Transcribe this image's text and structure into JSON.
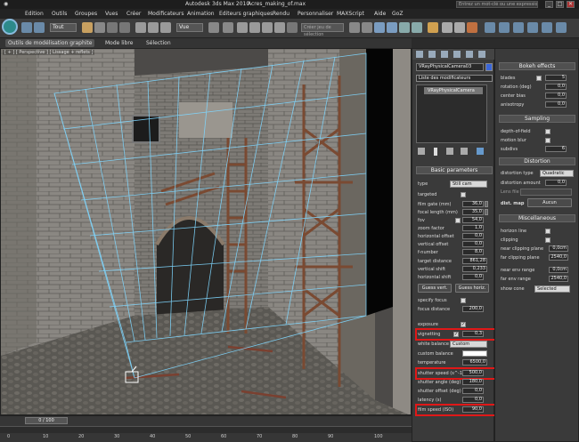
{
  "titlebar": {
    "app_title": "Autodesk 3ds Max 2010",
    "file_name": "Acres_making_of.max",
    "search_placeholder": "Entrez un mot-clé ou une expression",
    "min": "_",
    "max": "□",
    "close": "✕"
  },
  "menu": [
    "Edition",
    "Outils",
    "Groupes",
    "Vues",
    "Créer",
    "Modificateurs",
    "Animation",
    "Editeurs graphiques",
    "Rendu",
    "Personnaliser",
    "MAXScript",
    "Aide",
    "GoZ"
  ],
  "toolbar": {
    "selection_filter": "Tout",
    "coord_system": "Vue",
    "named_selection": "Créer jeu de sélection"
  },
  "ribbon": {
    "tabs": [
      "Outils de modélisation graphite",
      "Mode libre",
      "Sélection"
    ]
  },
  "viewport": {
    "label": "[ + ] [ Perspective ] [ Lissage + reflets ]"
  },
  "timeline": {
    "frame_counter": "0 / 100",
    "ticks": [
      "0",
      "10",
      "20",
      "30",
      "40",
      "50",
      "60",
      "70",
      "80",
      "90",
      "100"
    ]
  },
  "modifier": {
    "object_name": "VRayPhysicalCamera03",
    "color": "#3a66d8",
    "list_label": "Liste des modificateurs",
    "stack_item": "VRayPhysicalCamera"
  },
  "basic_params": {
    "title": "Basic parameters",
    "type_label": "type",
    "type_value": "Still cam",
    "targeted": "targeted",
    "film_gate": "film gate (mm)",
    "film_gate_value": "36,0",
    "focal_length": "focal length (mm)",
    "focal_length_value": "35,0",
    "fov": "fov",
    "fov_value": "54,0",
    "zoom_factor": "zoom factor",
    "zoom_factor_value": "1,0",
    "horizontal_offset": "horizontal offset",
    "horizontal_offset_value": "0,0",
    "vertical_offset": "vertical offset",
    "vertical_offset_value": "0,0",
    "f_number": "f-number",
    "f_number_value": "8,0",
    "target_distance": "target distance",
    "target_distance_value": "861,28",
    "vertical_shift": "vertical shift",
    "vertical_shift_value": "0,233",
    "horizontal_shift": "horizontal shift",
    "horizontal_shift_value": "0,0",
    "guess_vert": "Guess vert.",
    "guess_horiz": "Guess horiz.",
    "specify_focus": "specify focus",
    "focus_distance": "focus distance",
    "focus_distance_value": "200,0",
    "exposure": "exposure",
    "vignetting": "vignetting",
    "vignetting_value": "0,3",
    "white_balance": "white balance",
    "white_balance_value": "Custom",
    "custom_balance": "custom balance",
    "temperature": "temperature",
    "temperature_value": "6500,0",
    "shutter_speed": "shutter speed (s^-1)",
    "shutter_speed_value": "500,0",
    "shutter_angle": "shutter angle (deg)",
    "shutter_angle_value": "180,0",
    "shutter_offset": "shutter offset (deg)",
    "shutter_offset_value": "0,0",
    "latency": "latency (s)",
    "latency_value": "0,0",
    "film_speed": "film speed (ISO)",
    "film_speed_value": "90,0"
  },
  "bokeh": {
    "title": "Bokeh effects",
    "blades": "blades",
    "blades_value": "5",
    "rotation": "rotation (deg)",
    "rotation_value": "0,0",
    "center_bias": "center bias",
    "center_bias_value": "0,0",
    "anisotropy": "anisotropy",
    "anisotropy_value": "0,0"
  },
  "sampling": {
    "title": "Sampling",
    "dof": "depth-of-field",
    "motion_blur": "motion blur",
    "subdivs": "subdivs",
    "subdivs_value": "6"
  },
  "distortion": {
    "title": "Distortion",
    "type_label": "distortion type",
    "type_value": "Quadratic",
    "amount": "distortion amount",
    "amount_value": "0,0",
    "lens_file": "Lens file",
    "dist_map": "dist. map",
    "none": "Aucun"
  },
  "misc": {
    "title": "Miscellaneous",
    "horizon_line": "horizon line",
    "clipping": "clipping",
    "near_clip": "near clipping plane",
    "near_clip_value": "0,0cm",
    "far_clip": "far clipping plane",
    "far_clip_value": "2540,0",
    "near_env": "near env range",
    "near_env_value": "0,0cm",
    "far_env": "far env range",
    "far_env_value": "2540,0",
    "show_cone": "show cone",
    "show_cone_value": "Selected"
  },
  "colors": {
    "highlight": "#e01818",
    "ui_dark": "#2b2b2b",
    "panel": "#3a3a3a"
  }
}
